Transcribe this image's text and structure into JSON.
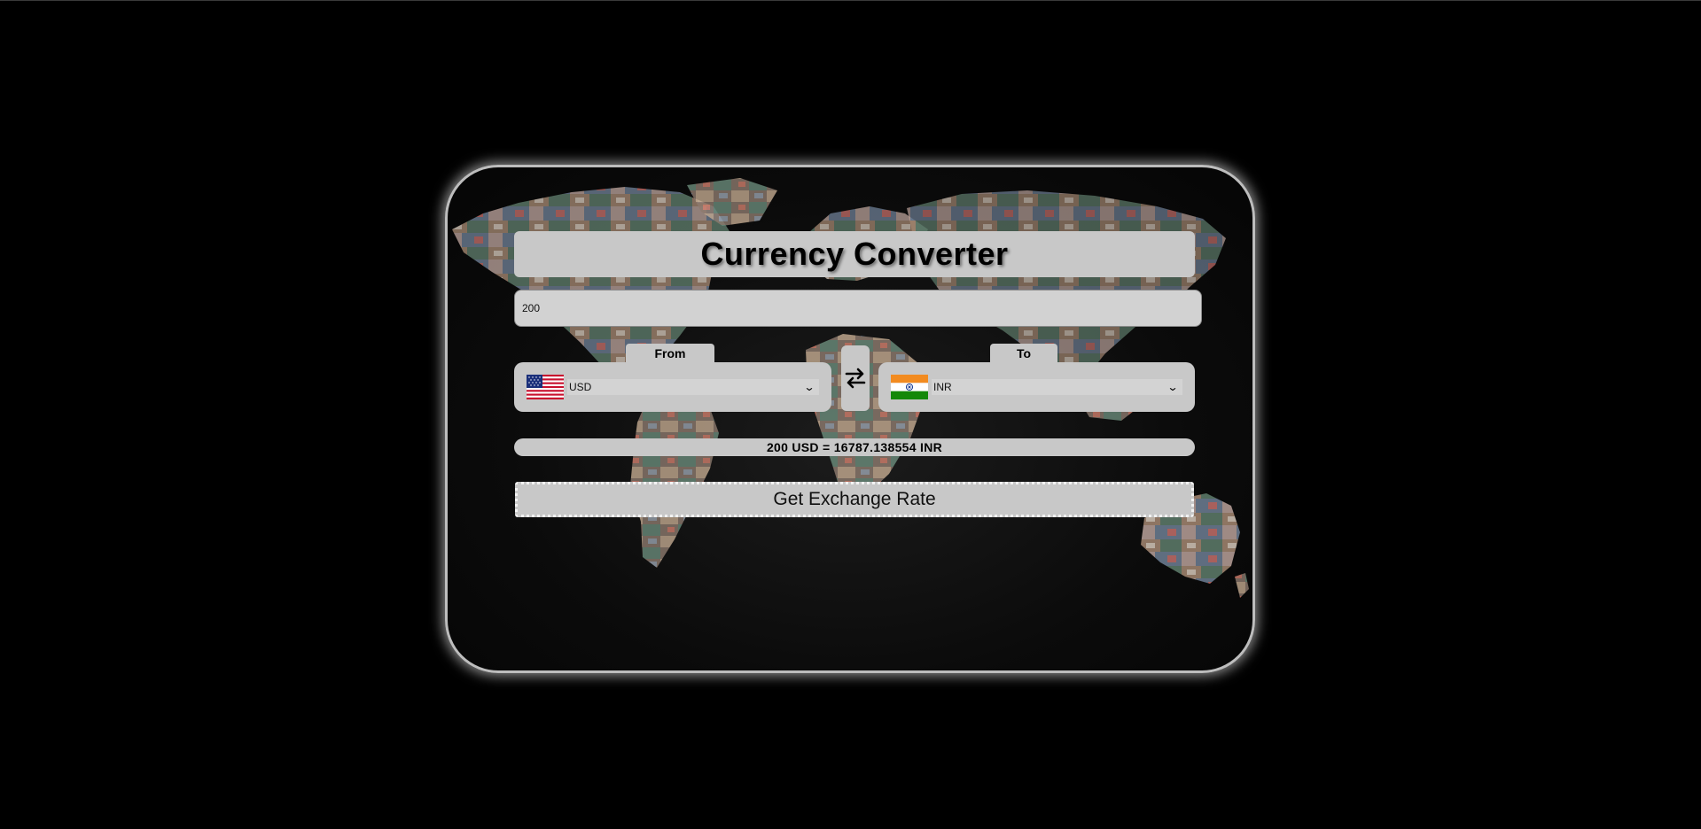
{
  "app": {
    "title": "Currency Converter"
  },
  "amount_input": {
    "value": "200"
  },
  "from": {
    "label": "From",
    "currency": "USD",
    "flag": "us-flag-icon"
  },
  "to": {
    "label": "To",
    "currency": "INR",
    "flag": "india-flag-icon"
  },
  "swap": {
    "icon": "swap-arrows-icon"
  },
  "result": {
    "text": "200 USD = 16787.138554 INR"
  },
  "actions": {
    "get_rate_label": "Get Exchange Rate"
  },
  "colors": {
    "page_background": "#000000",
    "panel_background": "#c8c8c8",
    "card_border": "#bdbdbd"
  }
}
